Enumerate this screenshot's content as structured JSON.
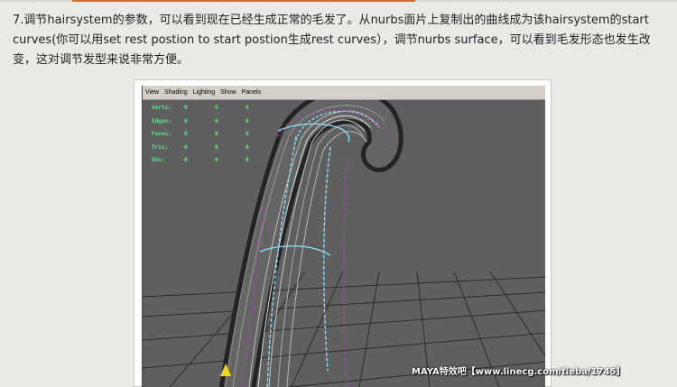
{
  "article": {
    "text": "7.调节hairsystem的参数，可以看到现在已经生成正常的毛发了。从nurbs面片上复制出的曲线成为该hairsystem的start curves(你可以用set rest postion to start postion生成rest curves），调节nurbs surface，可以看到毛发形态也发生改变，这对调节发型来说非常方便。"
  },
  "maya": {
    "menu": [
      "View",
      "Shading",
      "Lighting",
      "Show",
      "Panels"
    ],
    "hud": [
      {
        "label": "Verts:",
        "values": [
          "0",
          "0",
          "0"
        ]
      },
      {
        "label": "Edges:",
        "values": [
          "0",
          "0",
          "0"
        ]
      },
      {
        "label": "Faces:",
        "values": [
          "0",
          "0",
          "0"
        ]
      },
      {
        "label": "Tris:",
        "values": [
          "0",
          "0",
          "0"
        ]
      },
      {
        "label": "UVs:",
        "values": [
          "0",
          "0",
          "0"
        ]
      }
    ]
  },
  "watermark": "MAYA特效吧【www.linecg.com/tieba/1745】",
  "colors": {
    "page_bg": "#e9e9e5",
    "viewport_bg": "#5e5e5e",
    "grid": "#2a2a2a",
    "hud_text": "#66e08c",
    "curve_cyan": "#8fe6ff",
    "cv_magenta": "#c040c8"
  }
}
